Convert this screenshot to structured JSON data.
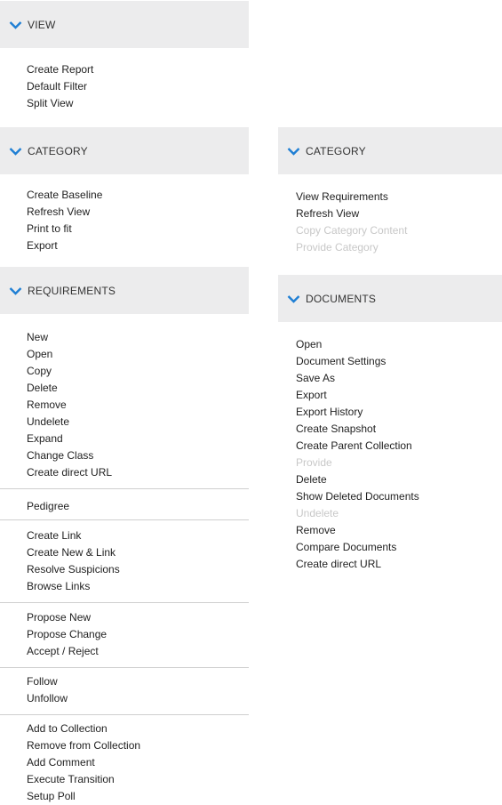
{
  "colors": {
    "accent": "#1f7fd4",
    "header_bg": "#ececed",
    "divider": "#cfcfcf",
    "disabled_text": "#c8c8c8"
  },
  "left": {
    "view": {
      "title": "VIEW",
      "items": [
        "Create Report",
        "Default Filter",
        "Split View"
      ]
    },
    "category": {
      "title": "CATEGORY",
      "items": [
        "Create Baseline",
        "Refresh View",
        "Print to fit",
        "Export"
      ]
    },
    "requirements": {
      "title": "REQUIREMENTS",
      "group1": [
        "New",
        "Open",
        "Copy",
        "Delete",
        "Remove",
        "Undelete",
        "Expand",
        "Change Class",
        "Create direct URL"
      ],
      "group2": [
        "Pedigree"
      ],
      "group3": [
        "Create Link",
        "Create New & Link",
        "Resolve Suspicions",
        "Browse Links"
      ],
      "group4": [
        "Propose New",
        "Propose Change",
        "Accept / Reject"
      ],
      "group5": [
        "Follow",
        "Unfollow"
      ],
      "group6": [
        "Add to Collection",
        "Remove from Collection",
        "Add Comment",
        "Execute Transition",
        "Setup Poll"
      ]
    }
  },
  "right": {
    "category": {
      "title": "CATEGORY",
      "items": [
        {
          "label": "View Requirements",
          "enabled": true
        },
        {
          "label": "Refresh View",
          "enabled": true
        },
        {
          "label": "Copy Category Content",
          "enabled": false
        },
        {
          "label": "Provide Category",
          "enabled": false
        }
      ]
    },
    "documents": {
      "title": "DOCUMENTS",
      "items": [
        {
          "label": "Open",
          "enabled": true
        },
        {
          "label": "Document Settings",
          "enabled": true
        },
        {
          "label": "Save As",
          "enabled": true
        },
        {
          "label": "Export",
          "enabled": true
        },
        {
          "label": "Export History",
          "enabled": true
        },
        {
          "label": "Create Snapshot",
          "enabled": true
        },
        {
          "label": "Create Parent Collection",
          "enabled": true
        },
        {
          "label": "Provide",
          "enabled": false
        },
        {
          "label": "Delete",
          "enabled": true
        },
        {
          "label": "Show Deleted Documents",
          "enabled": true
        },
        {
          "label": "Undelete",
          "enabled": false
        },
        {
          "label": "Remove",
          "enabled": true
        },
        {
          "label": "Compare Documents",
          "enabled": true
        },
        {
          "label": "Create direct URL",
          "enabled": true
        }
      ]
    }
  }
}
